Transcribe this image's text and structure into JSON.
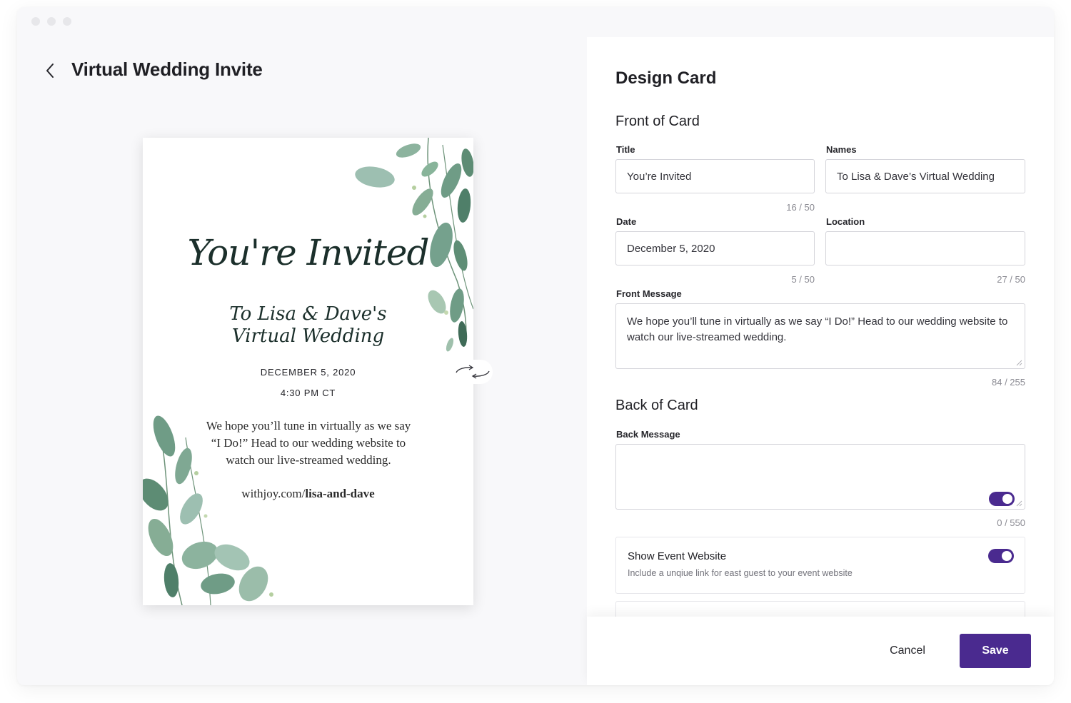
{
  "header": {
    "page_title": "Virtual Wedding Invite"
  },
  "card_preview": {
    "title": "You're Invited",
    "names": "To Lisa & Dave's Virtual Wedding",
    "date": "DECEMBER 5, 2020",
    "time": "4:30 PM CT",
    "message": "We hope you’ll tune in virtually as we say “I Do!” Head to our wedding website to watch our live-streamed wedding.",
    "url_prefix": "withjoy.com/",
    "url_slug": "lisa-and-dave"
  },
  "panel": {
    "title": "Design Card",
    "front": {
      "section_title": "Front of Card",
      "title_label": "Title",
      "title_value": "You’re Invited",
      "title_counter": "16 / 50",
      "names_label": "Names",
      "names_value": "To Lisa & Dave’s Virtual Wedding",
      "date_label": "Date",
      "date_value": "December 5, 2020",
      "date_counter": "5 / 50",
      "location_label": "Location",
      "location_value": "",
      "location_counter": "27 / 50",
      "message_label": "Front Message",
      "message_value": "We hope you’ll tune in virtually as we say “I Do!” Head to our wedding website to watch our live-streamed wedding.",
      "message_counter": "84 / 255"
    },
    "back": {
      "section_title": "Back of Card",
      "message_label": "Back Message",
      "message_value": "",
      "message_counter": "0 / 550",
      "message_toggle_on": true
    },
    "options": [
      {
        "title": "Show Event Website",
        "subtitle": "Include a unqiue link for east guest to your event website",
        "enabled": true
      }
    ],
    "footer": {
      "cancel_label": "Cancel",
      "save_label": "Save"
    }
  },
  "colors": {
    "accent": "#4a2a8f",
    "leaf": "#6f9c86",
    "script_text": "#1b2f2b"
  }
}
